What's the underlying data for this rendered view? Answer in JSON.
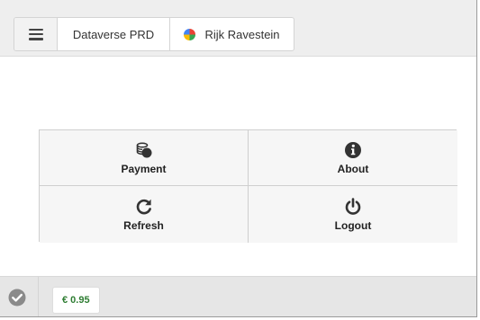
{
  "topbar": {
    "menu_icon": "hamburger-menu-icon",
    "server_name": "Dataverse PRD",
    "user_icon": "pie-chart-icon",
    "user_name": "Rijk Ravestein",
    "user_icon_colors": [
      "#4285f4",
      "#ea4335",
      "#fbbc05",
      "#34a853"
    ]
  },
  "menu": {
    "items": [
      {
        "label": "Payment",
        "icon": "coins-icon"
      },
      {
        "label": "About",
        "icon": "info-icon"
      },
      {
        "label": "Refresh",
        "icon": "refresh-icon"
      },
      {
        "label": "Logout",
        "icon": "power-icon"
      }
    ]
  },
  "footer": {
    "status_icon": "check-circle-icon",
    "balance": "€ 0.95",
    "balance_color": "#2e7d32"
  }
}
